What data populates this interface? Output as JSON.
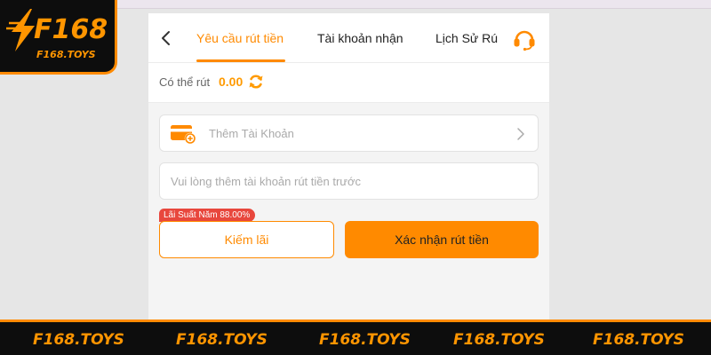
{
  "nav": {
    "tabs": [
      {
        "label": "Yêu cầu rút tiền",
        "active": true
      },
      {
        "label": "Tài khoản nhận",
        "active": false
      },
      {
        "label": "Lịch Sử Rú",
        "active": false
      }
    ]
  },
  "balance": {
    "label": "Có thể rút",
    "value": "0.00"
  },
  "account": {
    "add_label": "Thêm Tài Khoản"
  },
  "notice": {
    "text": "Vui lòng thêm tài khoản rút tiền trước"
  },
  "badge": {
    "text": "Lãi Suất Năm 88.00%"
  },
  "buttons": {
    "earn_label": "Kiếm lãi",
    "confirm_label": "Xác nhận rút tiền"
  },
  "brand": {
    "logo_text": "F168",
    "logo_subtext": "F168.TOYS",
    "footer_items": [
      "F168.TOYS",
      "F168.TOYS",
      "F168.TOYS",
      "F168.TOYS",
      "F168.TOYS"
    ]
  },
  "colors": {
    "accent": "#ff8a00",
    "balance": "#ff9a00",
    "badge": "#e8473d",
    "brand_bg": "#0d0d0d"
  },
  "icons": {
    "back": "chevron-left-icon",
    "support": "headset-icon",
    "refresh": "refresh-icon",
    "card": "card-add-icon",
    "chevron": "chevron-right-icon",
    "logo": "lightning-bolt-icon"
  }
}
